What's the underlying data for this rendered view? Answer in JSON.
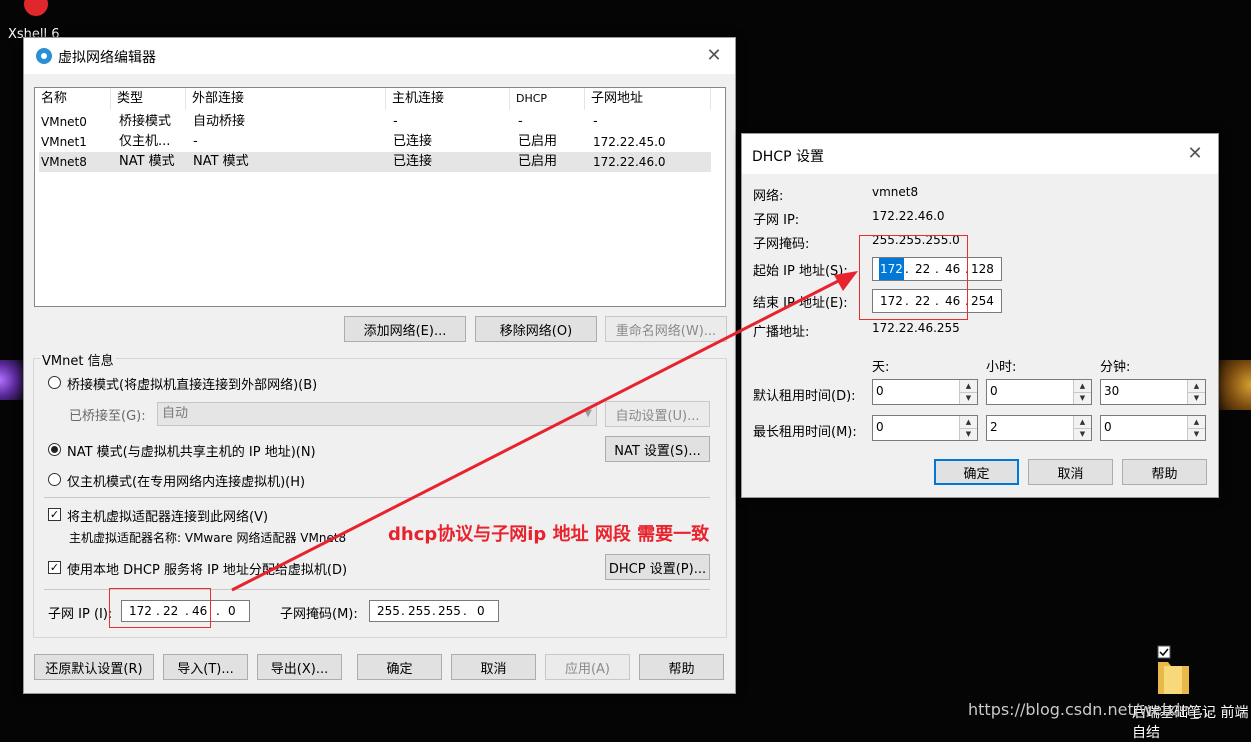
{
  "desktop": {
    "xshell_label": "Xshell 6",
    "folder_label": "后端基础笔记 前端自结",
    "watermark": "https://blog.csdn.net/weixin_..."
  },
  "vne": {
    "title": "虚拟网络编辑器",
    "columns": [
      "名称",
      "类型",
      "外部连接",
      "主机连接",
      "DHCP",
      "子网地址"
    ],
    "rows": [
      {
        "name": "VMnet0",
        "type": "桥接模式",
        "ext": "自动桥接",
        "host": "-",
        "dhcp": "-",
        "subnet": "-"
      },
      {
        "name": "VMnet1",
        "type": "仅主机...",
        "ext": "-",
        "host": "已连接",
        "dhcp": "已启用",
        "subnet": "172.22.45.0"
      },
      {
        "name": "VMnet8",
        "type": "NAT 模式",
        "ext": "NAT 模式",
        "host": "已连接",
        "dhcp": "已启用",
        "subnet": "172.22.46.0"
      }
    ],
    "add_network": "添加网络(E)...",
    "remove_network": "移除网络(O)",
    "rename_network": "重命名网络(W)...",
    "info_title": "VMnet 信息",
    "bridge_mode": "桥接模式(将虚拟机直接连接到外部网络)(B)",
    "bridged_to": "已桥接至(G):",
    "bridged_value": "自动",
    "auto_settings": "自动设置(U)...",
    "nat_mode": "NAT 模式(与虚拟机共享主机的 IP 地址)(N)",
    "nat_settings": "NAT 设置(S)...",
    "host_only": "仅主机模式(在专用网络内连接虚拟机)(H)",
    "connect_adapter": "将主机虚拟适配器连接到此网络(V)",
    "adapter_name": "主机虚拟适配器名称: VMware 网络适配器 VMnet8",
    "use_dhcp": "使用本地 DHCP 服务将 IP 地址分配给虚拟机(D)",
    "dhcp_settings": "DHCP 设置(P)...",
    "subnet_ip_label": "子网 IP (I):",
    "subnet_ip": [
      "172",
      "22",
      "46",
      "0"
    ],
    "subnet_mask_label": "子网掩码(M):",
    "subnet_mask": [
      "255",
      "255",
      "255",
      "0"
    ],
    "restore": "还原默认设置(R)",
    "import": "导入(T)...",
    "export": "导出(X)...",
    "ok": "确定",
    "cancel": "取消",
    "apply": "应用(A)",
    "help": "帮助"
  },
  "dhcp": {
    "title": "DHCP 设置",
    "network_label": "网络:",
    "network": "vmnet8",
    "subnet_ip_label": "子网 IP:",
    "subnet_ip": "172.22.46.0",
    "mask_label": "子网掩码:",
    "mask": "255.255.255.0",
    "start_label": "起始 IP 地址(S):",
    "start_ip": [
      "172",
      "22",
      "46",
      "128"
    ],
    "end_label": "结束 IP 地址(E):",
    "end_ip": [
      "172",
      "22",
      "46",
      "254"
    ],
    "broadcast_label": "广播地址:",
    "broadcast": "172.22.46.255",
    "day": "天:",
    "hour": "小时:",
    "minute": "分钟:",
    "default_lease_label": "默认租用时间(D):",
    "default_lease": [
      "0",
      "0",
      "30"
    ],
    "max_lease_label": "最长租用时间(M):",
    "max_lease": [
      "0",
      "2",
      "0"
    ],
    "ok": "确定",
    "cancel": "取消",
    "help": "帮助"
  },
  "annotation": {
    "text": "dhcp协议与子网ip 地址 网段 需要一致",
    "color": "#e8232e"
  }
}
